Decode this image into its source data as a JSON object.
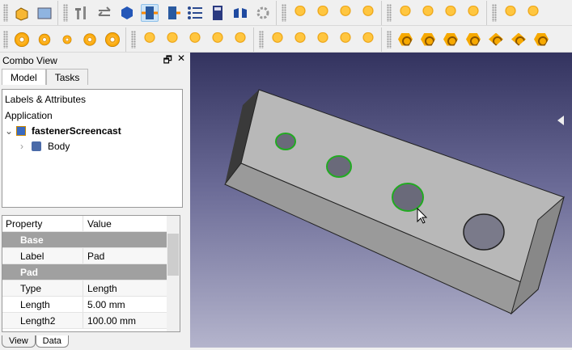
{
  "toolbar1": {
    "icons": [
      "part-design-icon",
      "open-folder-icon",
      "fasteners-icon",
      "swap-icon",
      "cube-icon",
      "bom-icon",
      "bom-alt-icon",
      "list-icon",
      "calculator-icon",
      "shape-icon",
      "gear-icon"
    ],
    "bolts": 8
  },
  "toolbar2": {
    "washers": 5,
    "screws": 10,
    "nuts": 7
  },
  "combo_view": {
    "title": "Combo View",
    "float": "🗗",
    "close": "✕",
    "tabs": [
      "Model",
      "Tasks"
    ]
  },
  "tree": {
    "header": "Labels & Attributes",
    "root": "Application",
    "document": "fastenerScreencast",
    "child": "Body"
  },
  "properties": {
    "headers": [
      "Property",
      "Value"
    ],
    "rows": [
      {
        "group": "Base"
      },
      {
        "name": "Label",
        "value": "Pad"
      },
      {
        "group": "Pad"
      },
      {
        "name": "Type",
        "value": "Length"
      },
      {
        "name": "Length",
        "value": "5.00 mm"
      },
      {
        "name": "Length2",
        "value": "100.00 mm"
      }
    ]
  },
  "bottom_tabs": [
    "View",
    "Data"
  ],
  "colors": {
    "highlight": "#22aa22",
    "face": "#b4b4b4"
  }
}
